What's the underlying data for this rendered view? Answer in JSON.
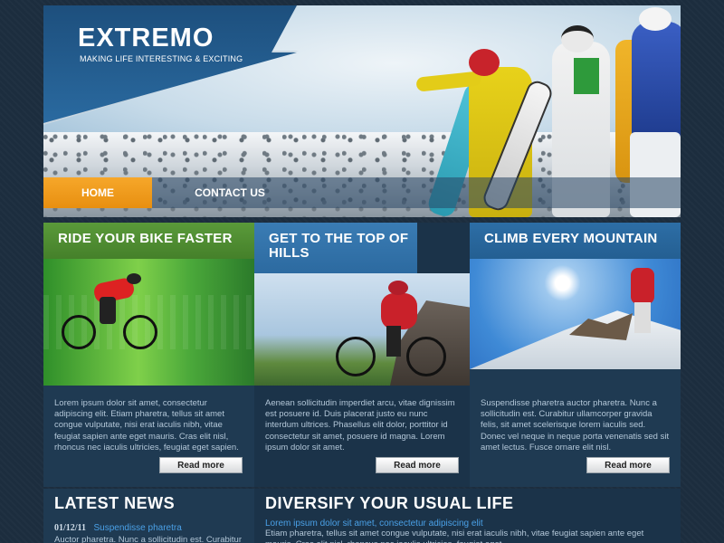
{
  "header": {
    "logo": "EXTREMO",
    "tagline": "MAKING LIFE INTERESTING & EXCITING"
  },
  "nav": {
    "items": [
      {
        "label": "HOME",
        "active": true
      },
      {
        "label": "CONTACT US",
        "active": false
      }
    ]
  },
  "features": [
    {
      "title": "RIDE YOUR BIKE FASTER",
      "text": "Lorem ipsum dolor sit amet, consectetur adipiscing elit. Etiam pharetra, tellus sit amet congue vulputate, nisi erat iaculis nibh, vitae feugiat sapien ante eget mauris. Cras elit nisl, rhoncus nec iaculis ultricies, feugiat eget sapien.",
      "button": "Read more"
    },
    {
      "title": "GET TO THE TOP OF HILLS",
      "text": "Aenean sollicitudin imperdiet arcu, vitae dignissim est posuere id. Duis placerat justo eu nunc interdum ultrices. Phasellus elit dolor, porttitor id consectetur sit amet, posuere id magna. Lorem ipsum dolor sit amet.",
      "button": "Read more"
    },
    {
      "title": "CLIMB EVERY MOUNTAIN",
      "text": "Suspendisse pharetra auctor pharetra. Nunc a sollicitudin est. Curabitur ullamcorper gravida felis, sit amet scelerisque lorem iaculis sed. Donec vel neque in neque porta venenatis sed sit amet lectus. Fusce ornare elit nisl.",
      "button": "Read more"
    }
  ],
  "latest_news": {
    "title": "LATEST NEWS",
    "date": "01/12/11",
    "link": "Suspendisse pharetra",
    "text": "Auctor pharetra. Nunc a sollicitudin est. Curabitur ullamcorper gravida felis, sit"
  },
  "diversify": {
    "title": "DIVERSIFY YOUR USUAL LIFE",
    "link": "Lorem ipsum dolor sit amet, consectetur adipiscing elit",
    "text": "Etiam pharetra, tellus sit amet congue vulputate, nisi erat iaculis nibh, vitae feugiat sapien ante eget mauris. Cras elit nisl, rhoncus nec iaculis ultricies, feugiat eget"
  },
  "colors": {
    "background": "#1c2d3e",
    "nav_active": "#f19a1a",
    "feature1_head": "#4f8a32",
    "feature2_head": "#2f6fa6",
    "feature3_head": "#2a6aa0",
    "link": "#4aa0e6"
  }
}
